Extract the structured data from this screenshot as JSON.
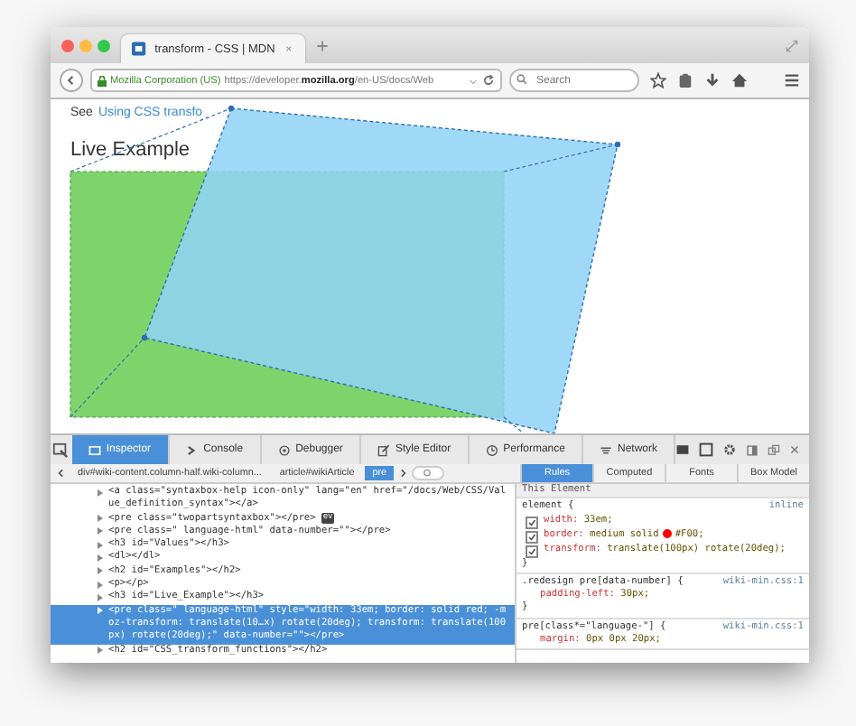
{
  "browser": {
    "tab": {
      "title": "transform - CSS | MDN",
      "selected": true
    },
    "identity": "Mozilla Corporation (US)",
    "url_prefix": "https://developer.",
    "url_domain": "mozilla.org",
    "url_path": "/en-US/docs/Web",
    "search": {
      "placeholder": "Search"
    }
  },
  "page": {
    "intro": "See",
    "link": "Using CSS transfo",
    "heading": "Live Example"
  },
  "devtools": {
    "tools": [
      {
        "label": "Inspector",
        "selected": true
      },
      {
        "label": "Console",
        "selected": false
      },
      {
        "label": "Debugger",
        "selected": false
      },
      {
        "label": "Style Editor",
        "selected": false
      },
      {
        "label": "Performance",
        "selected": false
      },
      {
        "label": "Network",
        "selected": false
      }
    ],
    "breadcrumbs": [
      {
        "label": "div#wiki-content.column-half.wiki-column...",
        "selected": false
      },
      {
        "label": "article#wikiArticle",
        "selected": false
      },
      {
        "label": "pre",
        "selected": true
      }
    ],
    "markup": [
      {
        "text": "<a class=\"syntaxbox-help icon-only\" lang=\"en\" href=\"/docs/Web/CSS/Value_definition_syntax\"></a>",
        "selected": false
      },
      {
        "text": "<pre class=\"twopartsyntaxbox\"></pre>",
        "badge": "ev",
        "selected": false
      },
      {
        "text": "<pre class=\" language-html\" data-number=\"\"></pre>",
        "selected": false
      },
      {
        "text": "<h3 id=\"Values\"></h3>",
        "selected": false
      },
      {
        "text": "<dl></dl>",
        "selected": false
      },
      {
        "text": "<h2 id=\"Examples\"></h2>",
        "selected": false
      },
      {
        "text": "<p></p>",
        "selected": false
      },
      {
        "text": "<h3 id=\"Live_Example\"></h3>",
        "selected": false
      },
      {
        "text": "<pre class=\" language-html\" style=\"width: 33em; border: solid red; -moz-transform: translate(10…x) rotate(20deg); transform: translate(100px) rotate(20deg);\" data-number=\"\"></pre>",
        "selected": true
      },
      {
        "text": "<h2 id=\"CSS_transform_functions\"></h2>",
        "selected": false
      }
    ],
    "sidebar_tabs": [
      {
        "label": "Rules",
        "selected": true
      },
      {
        "label": "Computed",
        "selected": false
      },
      {
        "label": "Fonts",
        "selected": false
      },
      {
        "label": "Box Model",
        "selected": false
      }
    ],
    "rules_header": "This Element",
    "rules": [
      {
        "selector": "element {",
        "source": "inline",
        "declarations": [
          {
            "property": "width:",
            "value": "33em;",
            "checked": true
          },
          {
            "property": "border:",
            "value": "medium solid",
            "color": "#ff0000",
            "value_after": "#F00;",
            "checked": true
          },
          {
            "property": "transform:",
            "value": "translate(100px) rotate(20deg);",
            "checked": true
          }
        ],
        "close": "}"
      },
      {
        "selector": ".redesign pre[data-number] {",
        "source": "wiki-min.css:1",
        "declarations": [
          {
            "property": "padding-left:",
            "value": "30px;",
            "checked": false
          }
        ],
        "close": "}"
      },
      {
        "selector": "pre[class*=\"language-\"] {",
        "source": "wiki-min.css:1",
        "declarations": [
          {
            "property": "margin:",
            "value": "0px 0px 20px;",
            "checked": false
          }
        ]
      }
    ]
  }
}
